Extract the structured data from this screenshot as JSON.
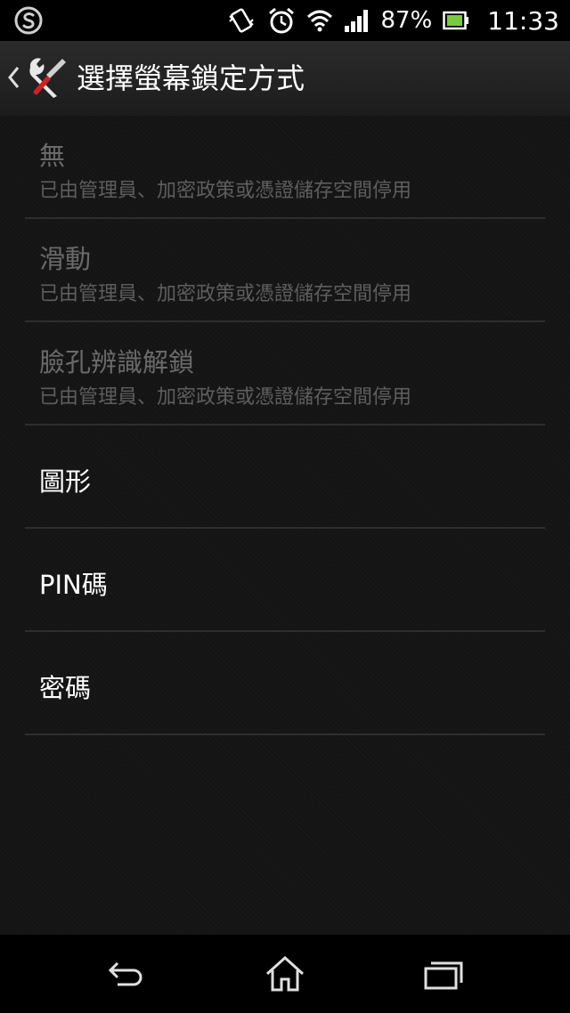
{
  "status_bar": {
    "battery_percent": "87%",
    "time": "11:33",
    "icons": [
      "sony-s-icon",
      "vibrate-icon",
      "alarm-icon",
      "wifi-icon",
      "signal-icon",
      "battery-icon"
    ]
  },
  "action_bar": {
    "title": "選擇螢幕鎖定方式",
    "icon": "settings-tools-icon"
  },
  "lock_options": [
    {
      "title": "無",
      "summary": "已由管理員、加密政策或憑證儲存空間停用",
      "enabled": false
    },
    {
      "title": "滑動",
      "summary": "已由管理員、加密政策或憑證儲存空間停用",
      "enabled": false
    },
    {
      "title": "臉孔辨識解鎖",
      "summary": "已由管理員、加密政策或憑證儲存空間停用",
      "enabled": false
    },
    {
      "title": "圖形",
      "summary": "",
      "enabled": true
    },
    {
      "title": "PIN碼",
      "summary": "",
      "enabled": true
    },
    {
      "title": "密碼",
      "summary": "",
      "enabled": true
    }
  ],
  "nav_bar": {
    "icons": [
      "back-icon",
      "home-icon",
      "recents-icon"
    ]
  },
  "colors": {
    "background": "#121212",
    "text_enabled": "#ffffff",
    "text_disabled": "#6a6a6a",
    "divider": "#2e2e2e"
  }
}
